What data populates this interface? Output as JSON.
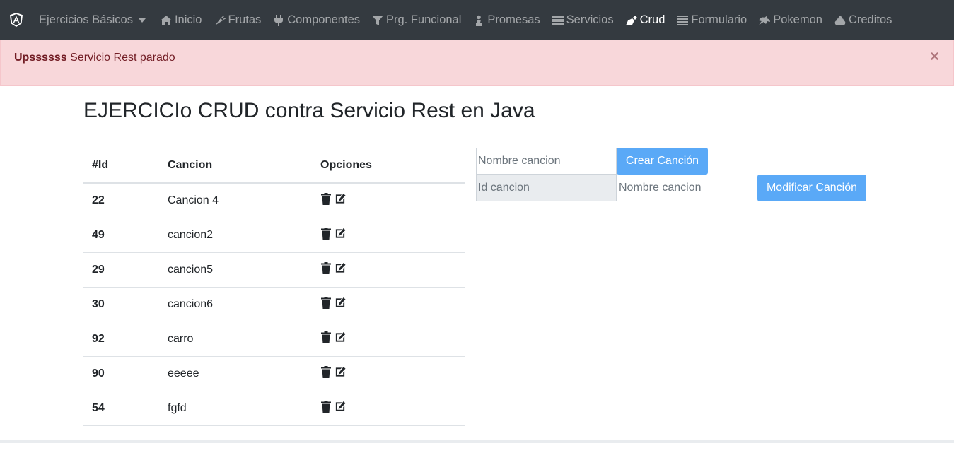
{
  "navbar": {
    "dropdown_label": "Ejercicios Básicos",
    "items": [
      {
        "label": "Inicio",
        "icon": "home-icon"
      },
      {
        "label": "Frutas",
        "icon": "carrot-icon"
      },
      {
        "label": "Componentes",
        "icon": "plug-icon"
      },
      {
        "label": "Prg. Funcional",
        "icon": "filter-icon"
      },
      {
        "label": "Promesas",
        "icon": "chess-pawn-icon"
      },
      {
        "label": "Servicios",
        "icon": "server-icon"
      },
      {
        "label": "Crud",
        "icon": "pen-nib-icon",
        "active": true
      },
      {
        "label": "Formulario",
        "icon": "list-icon"
      },
      {
        "label": "Pokemon",
        "icon": "dragon-icon"
      },
      {
        "label": "Creditos",
        "icon": "poo-icon"
      }
    ]
  },
  "alert": {
    "strong": "Upssssss",
    "message": " Servicio Rest parado",
    "close": "×"
  },
  "title": "EJERCICIo CRUD contra Servicio Rest en Java",
  "table": {
    "headers": [
      "#Id",
      "Cancion",
      "Opciones"
    ],
    "rows": [
      {
        "id": "22",
        "name": "Cancion 4"
      },
      {
        "id": "49",
        "name": "cancion2"
      },
      {
        "id": "29",
        "name": "cancion5"
      },
      {
        "id": "30",
        "name": "cancion6"
      },
      {
        "id": "92",
        "name": "carro"
      },
      {
        "id": "90",
        "name": "eeeee"
      },
      {
        "id": "54",
        "name": "fgfd"
      }
    ]
  },
  "create_form": {
    "name_placeholder": "Nombre cancion",
    "button": "Crear Canción"
  },
  "modify_form": {
    "id_placeholder": "Id cancion",
    "name_placeholder": "Nombre cancion",
    "button": "Modificar Canción"
  },
  "colors": {
    "navbar": "#343a40",
    "alert_bg": "#f8d7da",
    "alert_text": "#721c24",
    "button": "#5aa9f7"
  }
}
